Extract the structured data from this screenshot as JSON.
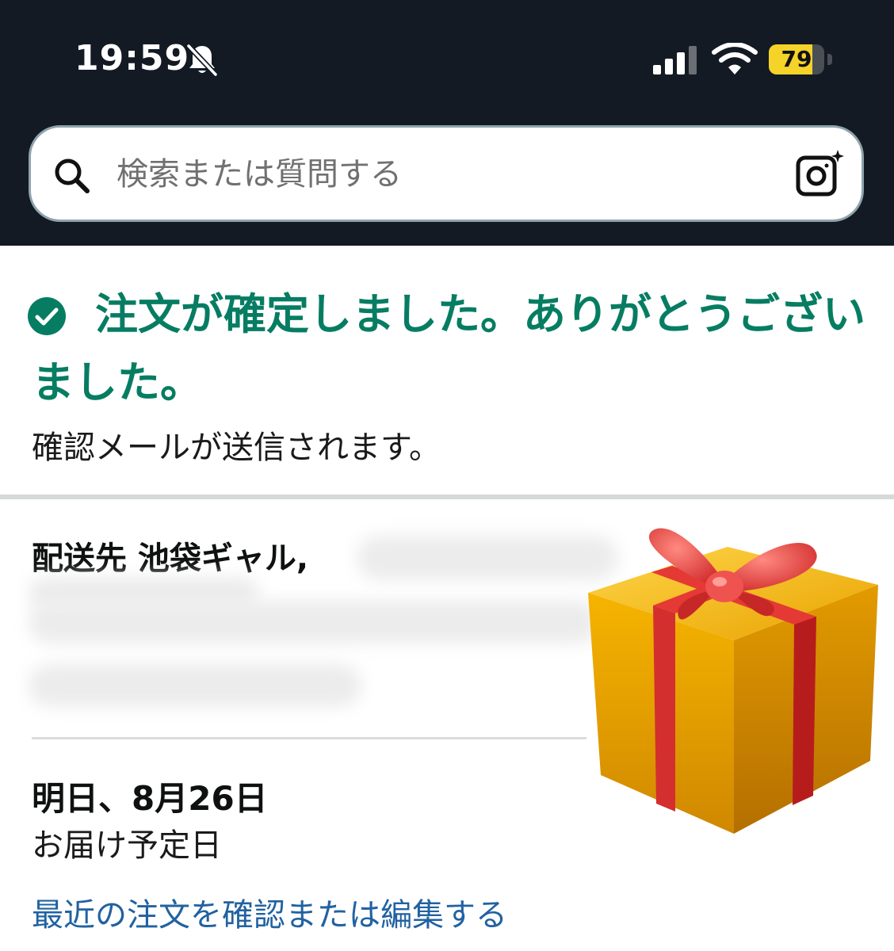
{
  "status_bar": {
    "time": "19:59",
    "battery_level": "79",
    "battery_fraction": 0.79,
    "battery_color": "#f5d328",
    "icons": [
      "bell-slash-icon",
      "cellular-signal-icon",
      "wifi-icon",
      "battery-icon"
    ]
  },
  "search": {
    "placeholder": "検索または質問する",
    "icons": [
      "search-icon",
      "camera-icon"
    ]
  },
  "confirmation": {
    "title": "注文が確定しました。ありがとうございました。",
    "subtitle": "確認メールが送信されます。",
    "icon": "check-circle-icon",
    "accent_color": "#067d62"
  },
  "delivery": {
    "ship_to_label": "配送先 池袋ギャル,",
    "date": "明日、8月26日",
    "date_caption": "お届け予定日",
    "orders_link": "最近の注文を確認または編集する",
    "link_color": "#2162a1"
  },
  "decoration": {
    "emoji": "gift-icon"
  }
}
